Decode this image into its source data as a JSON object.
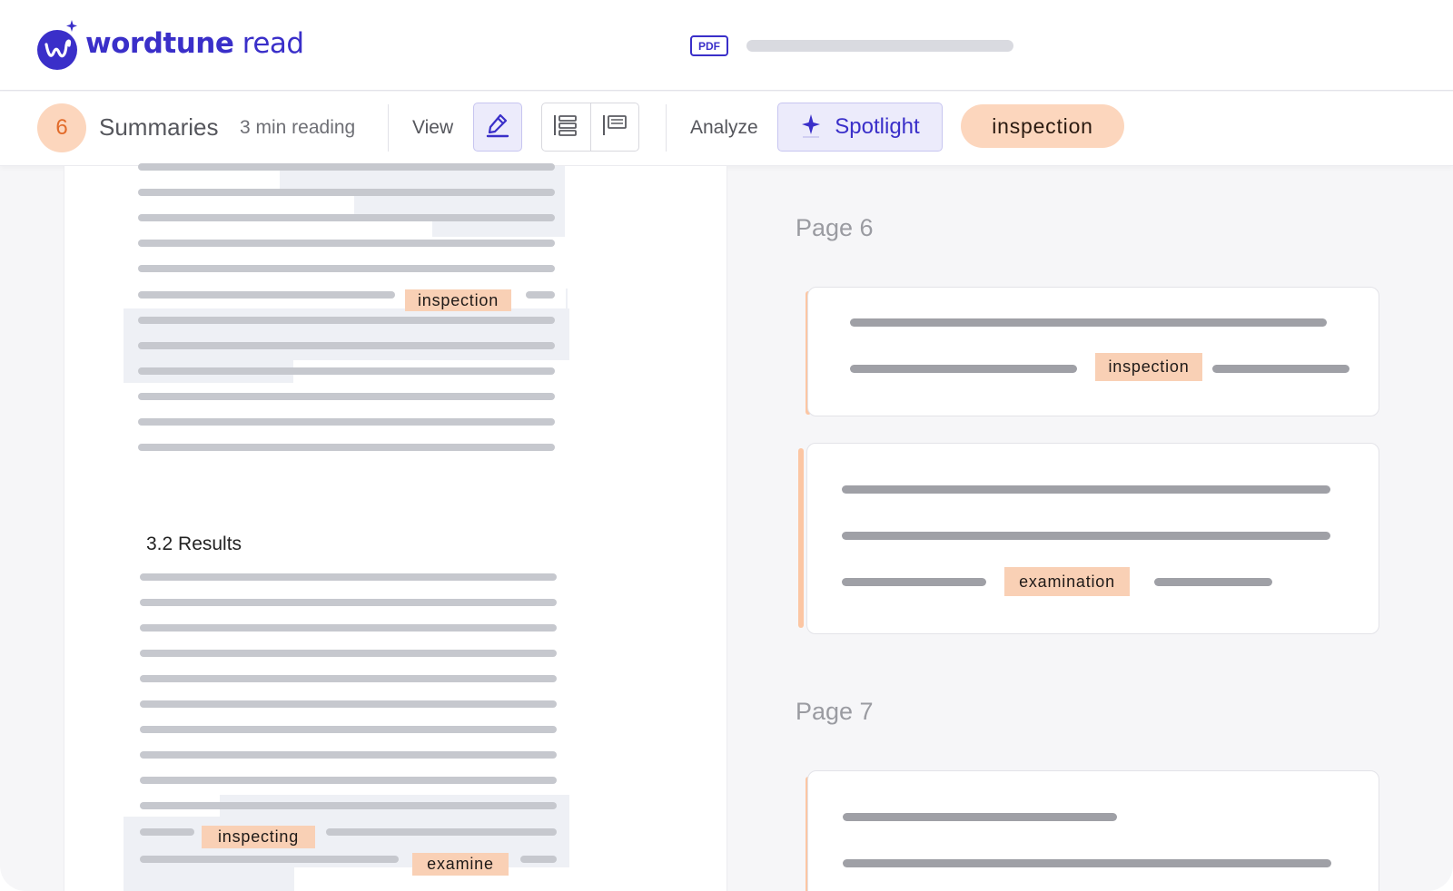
{
  "brand": {
    "name_bold": "wordtune",
    "name_light": " read"
  },
  "header": {
    "file_type": "PDF"
  },
  "toolbar": {
    "summary_count": "6",
    "summaries_label": "Summaries",
    "reading_time": "3 min reading",
    "view_label": "View",
    "analyze_label": "Analyze",
    "spotlight_label": "Spotlight",
    "spotlight_keyword": "inspection"
  },
  "document": {
    "section_heading": "3.2 Results",
    "highlights": [
      "inspection",
      "inspecting",
      "examine"
    ]
  },
  "summary": {
    "pages": [
      {
        "label": "Page 6",
        "cards": [
          {
            "keyword": "inspection"
          },
          {
            "keyword": "examination"
          }
        ]
      },
      {
        "label": "Page 7",
        "cards": [
          {}
        ]
      }
    ]
  },
  "colors": {
    "brand": "#3a2fc9",
    "keyword_bg": "#f9d0b5",
    "accent": "#fcc6a3"
  }
}
